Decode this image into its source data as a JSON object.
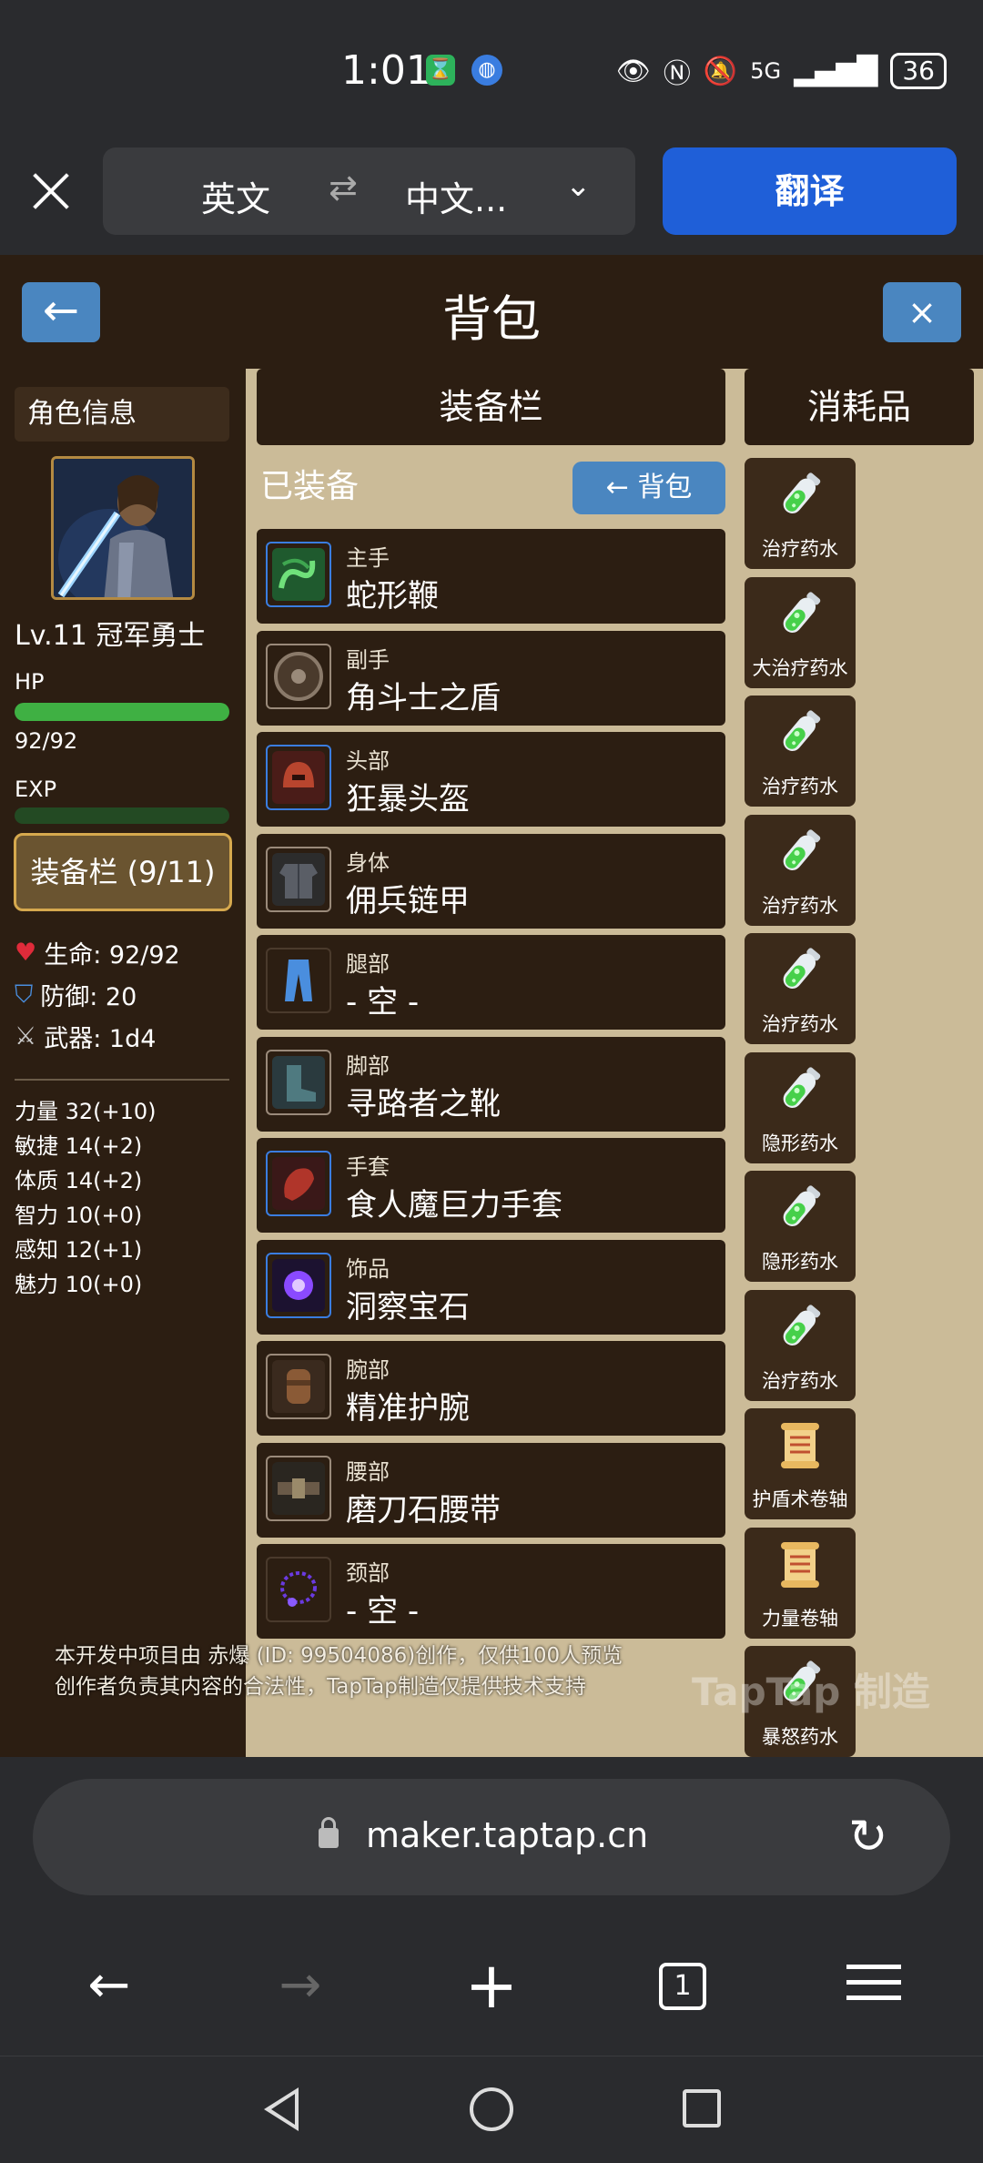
{
  "status_bar": {
    "time": "1:01",
    "signal": "5G",
    "battery": "36"
  },
  "translate_bar": {
    "source_lang": "英文",
    "swap_icon": "⇄",
    "target_lang": "中文...",
    "translate_button": "翻译"
  },
  "game": {
    "title": "背包",
    "back_arrow": "←",
    "close_x": "×",
    "character": {
      "tab": "角色信息",
      "level_name": "Lv.11 冠军勇士",
      "hp_label": "HP",
      "hp_value": "92/92",
      "hp_fraction": 1.0,
      "exp_label": "EXP",
      "exp_fraction": 0.0,
      "equip_button": "装备栏 (9/11)",
      "life": "生命: 92/92",
      "defense": "防御: 20",
      "weapon": "武器: 1d4",
      "attributes": [
        "力量 32(+10)",
        "敏捷 14(+2)",
        "体质 14(+2)",
        "智力 10(+0)",
        "感知 12(+1)",
        "魅力 10(+0)"
      ]
    },
    "equipment": {
      "header": "装备栏",
      "equipped_label": "已装备",
      "back_to_bag": "← 背包",
      "slots": [
        {
          "slot": "主手",
          "item": "蛇形鞭",
          "icon": "whip-icon"
        },
        {
          "slot": "副手",
          "item": "角斗士之盾",
          "icon": "shield-icon"
        },
        {
          "slot": "头部",
          "item": "狂暴头盔",
          "icon": "helmet-icon"
        },
        {
          "slot": "身体",
          "item": "佣兵链甲",
          "icon": "chainmail-icon"
        },
        {
          "slot": "腿部",
          "item": "- 空 -",
          "icon": "pants-icon"
        },
        {
          "slot": "脚部",
          "item": "寻路者之靴",
          "icon": "boots-icon"
        },
        {
          "slot": "手套",
          "item": "食人魔巨力手套",
          "icon": "gloves-icon"
        },
        {
          "slot": "饰品",
          "item": "洞察宝石",
          "icon": "gem-icon"
        },
        {
          "slot": "腕部",
          "item": "精准护腕",
          "icon": "bracer-icon"
        },
        {
          "slot": "腰部",
          "item": "磨刀石腰带",
          "icon": "belt-icon"
        },
        {
          "slot": "颈部",
          "item": "- 空 -",
          "icon": "necklace-icon"
        }
      ]
    },
    "consumables": {
      "header": "消耗品",
      "items": [
        {
          "name": "治疗药水",
          "icon": "potion-icon"
        },
        {
          "name": "大治疗药水",
          "icon": "potion-icon"
        },
        {
          "name": "治疗药水",
          "icon": "potion-icon"
        },
        {
          "name": "治疗药水",
          "icon": "potion-icon"
        },
        {
          "name": "治疗药水",
          "icon": "potion-icon"
        },
        {
          "name": "隐形药水",
          "icon": "potion-icon"
        },
        {
          "name": "隐形药水",
          "icon": "potion-icon"
        },
        {
          "name": "治疗药水",
          "icon": "potion-icon"
        },
        {
          "name": "护盾术卷轴",
          "icon": "scroll-icon"
        },
        {
          "name": "力量卷轴",
          "icon": "scroll-icon"
        },
        {
          "name": "暴怒药水",
          "icon": "potion-icon"
        }
      ]
    },
    "disclaimer_line1": "本开发中项目由 赤爆 (ID: 99504086)创作，仅供100人预览",
    "disclaimer_line2": "创作者负责其内容的合法性，TapTap制造仅提供技术支持",
    "watermark": "TapTap 制造"
  },
  "browser": {
    "url": "maker.taptap.cn",
    "tab_count": "1"
  }
}
